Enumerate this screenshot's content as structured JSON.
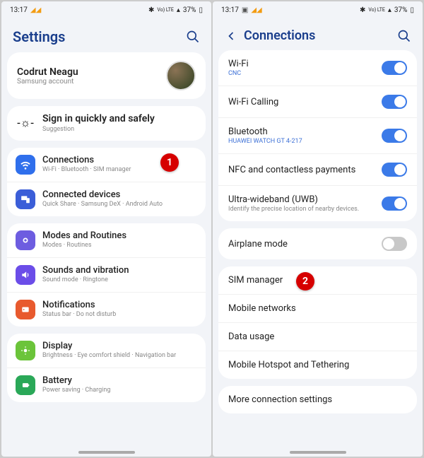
{
  "statusbar": {
    "time": "13:17",
    "signal": "Vo) LTE",
    "battery": "37%"
  },
  "left": {
    "title": "Settings",
    "account": {
      "name": "Codrut Neagu",
      "sub": "Samsung account"
    },
    "suggest": {
      "title": "Sign in quickly and safely",
      "sub": "Suggestion"
    },
    "items1": [
      {
        "title": "Connections",
        "sub": "Wi-Fi · Bluetooth · SIM manager",
        "bg": "#2f6fec",
        "badge": "1"
      },
      {
        "title": "Connected devices",
        "sub": "Quick Share · Samsung DeX · Android Auto",
        "bg": "#3b5ed8"
      }
    ],
    "items2": [
      {
        "title": "Modes and Routines",
        "sub": "Modes · Routines",
        "bg": "#6d5de0"
      },
      {
        "title": "Sounds and vibration",
        "sub": "Sound mode · Ringtone",
        "bg": "#6b4de8"
      },
      {
        "title": "Notifications",
        "sub": "Status bar · Do not disturb",
        "bg": "#e85a2e"
      }
    ],
    "items3": [
      {
        "title": "Display",
        "sub": "Brightness · Eye comfort shield · Navigation bar",
        "bg": "#6bc43a"
      },
      {
        "title": "Battery",
        "sub": "Power saving · Charging",
        "bg": "#2aa858"
      }
    ]
  },
  "right": {
    "title": "Connections",
    "group1": [
      {
        "title": "Wi-Fi",
        "sub": "CNC",
        "subcolor": "blue",
        "on": true
      },
      {
        "title": "Wi-Fi Calling",
        "on": true
      },
      {
        "title": "Bluetooth",
        "sub": "HUAWEI WATCH GT 4-217",
        "subcolor": "blue",
        "on": true
      },
      {
        "title": "NFC and contactless payments",
        "on": true
      },
      {
        "title": "Ultra-wideband (UWB)",
        "sub": "Identify the precise location of nearby devices.",
        "on": true
      }
    ],
    "group2": [
      {
        "title": "Airplane mode",
        "on": false
      }
    ],
    "group3": [
      {
        "title": "SIM manager",
        "badge": "2"
      },
      {
        "title": "Mobile networks"
      },
      {
        "title": "Data usage"
      },
      {
        "title": "Mobile Hotspot and Tethering"
      }
    ],
    "group4": [
      {
        "title": "More connection settings"
      }
    ]
  }
}
